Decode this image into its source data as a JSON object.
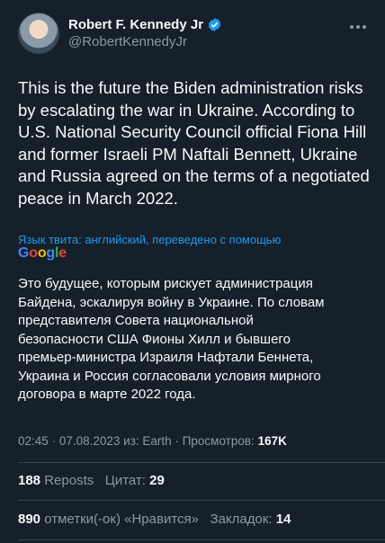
{
  "author": {
    "name": "Robert F. Kennedy Jr",
    "handle": "@RobertKennedyJr"
  },
  "tweet": {
    "text": "This is the future the Biden administration risks\nby escalating the war in Ukraine. According to\nU.S. National Security Council official Fiona Hill\nand former Israeli PM Naftali Bennett, Ukraine\nand Russia agreed on the terms of a negotiated\npeace in March 2022."
  },
  "translation": {
    "label": "Язык твита: английский, переведено с помощью",
    "provider": "Google",
    "text": "Это будущее, которым рискует администрация\nБайдена, эскалируя войну в Украине. По словам\nпредставителя Совета национальной\nбезопасности США Фионы Хилл и бывшего\nпремьер-министра Израиля Нафтали Беннета,\nУкраина и Россия согласовали условия мирного\nдоговора в марте 2022 года."
  },
  "meta": {
    "time": "02:45",
    "date": "07.08.2023",
    "source": "из: Earth",
    "views_label": "Просмотров:",
    "views": "167K"
  },
  "stats": {
    "reposts_count": "188",
    "reposts_label": "Reposts",
    "quotes_label": "Цитат:",
    "quotes_count": "29",
    "likes_count": "890",
    "likes_label": "отметки(-ок) «Нравится»",
    "bookmarks_label": "Закладок:",
    "bookmarks_count": "14"
  },
  "colors": {
    "background": "#15202b",
    "accent": "#1d9bf0",
    "muted": "#8b98a5"
  }
}
